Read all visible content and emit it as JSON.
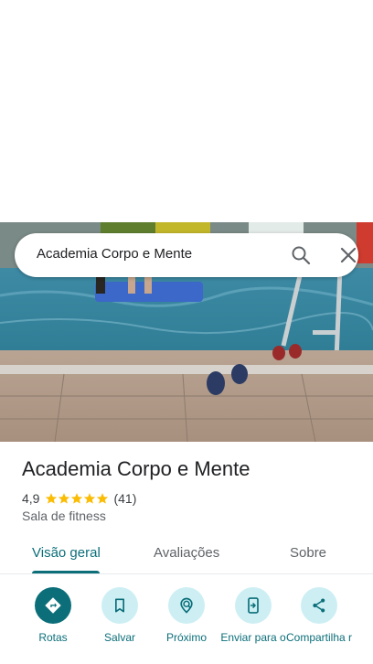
{
  "search": {
    "query": "Academia Corpo e Mente"
  },
  "place": {
    "name": "Academia Corpo e Mente",
    "rating": "4,9",
    "rating_value": 4.9,
    "review_count": "(41)",
    "category": "Sala de fitness"
  },
  "tabs": [
    {
      "label": "Visão geral",
      "active": true
    },
    {
      "label": "Avaliações",
      "active": false
    },
    {
      "label": "Sobre",
      "active": false
    }
  ],
  "actions": [
    {
      "label": "Rotas",
      "icon": "directions-icon"
    },
    {
      "label": "Salvar",
      "icon": "bookmark-icon"
    },
    {
      "label": "Próximo",
      "icon": "nearby-icon"
    },
    {
      "label": "Enviar para o",
      "icon": "send-to-phone-icon"
    },
    {
      "label": "Compartilha r",
      "icon": "share-icon"
    }
  ],
  "colors": {
    "accent": "#0b6e79",
    "action_bg": "#cdeff4",
    "star": "#fbbc04",
    "text": "#202124"
  }
}
